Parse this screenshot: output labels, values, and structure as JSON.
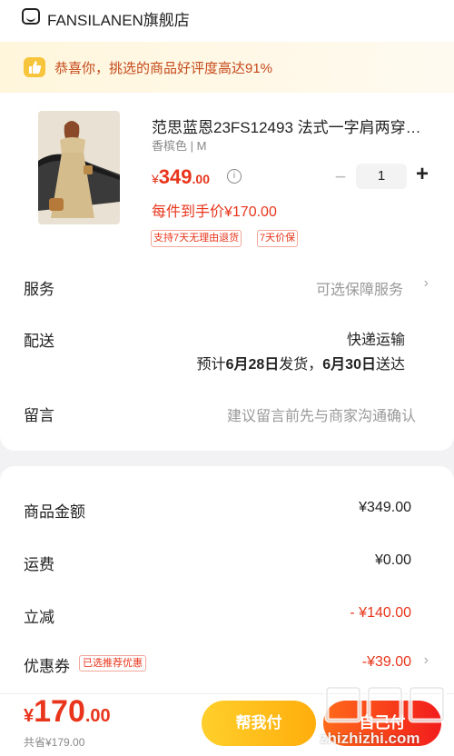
{
  "store": {
    "name": "FANSILANEN旗舰店",
    "banner_text": "恭喜你，挑选的商品好评度高达91%"
  },
  "product": {
    "title": "范思蓝恩23FS12493 法式一字肩两穿…",
    "spec": "香槟色 | M",
    "price_currency": "¥",
    "price_int": "349",
    "price_dec": ".00",
    "quantity": "1",
    "hand_price": "每件到手价¥170.00",
    "tags": [
      "支持7天无理由退货",
      "7天价保"
    ]
  },
  "rows": {
    "service_label": "服务",
    "service_hint": "可选保障服务",
    "delivery_label": "配送",
    "delivery_method": "快递运输",
    "delivery_prefix": "预计",
    "delivery_ship_date": "6月28日",
    "delivery_mid": "发货，",
    "delivery_arrive_date": "6月30日",
    "delivery_suffix": "送达",
    "note_label": "留言",
    "note_placeholder": "建议留言前先与商家沟通确认"
  },
  "fees": {
    "goods_label": "商品金额",
    "goods_value": "¥349.00",
    "shipping_label": "运费",
    "shipping_value": "¥0.00",
    "discount_label": "立减",
    "discount_value": "- ¥140.00",
    "coupon_label": "优惠券",
    "coupon_badge": "已选推荐优惠",
    "coupon_value": "-¥39.00"
  },
  "footer": {
    "total_currency": "¥",
    "total_int": "170",
    "total_dec": ".00",
    "saved": "共省¥179.00",
    "help_button": "帮我付",
    "pay_button": "自己付",
    "watermark": "zhizhizhi.com"
  },
  "colors": {
    "accent_red": "#e8351b",
    "help_yellow": "#ffbe1e"
  },
  "icons": [
    "store-icon",
    "thumbs-up-icon",
    "info-icon",
    "minus-icon",
    "plus-icon",
    "chevron-right-icon"
  ]
}
